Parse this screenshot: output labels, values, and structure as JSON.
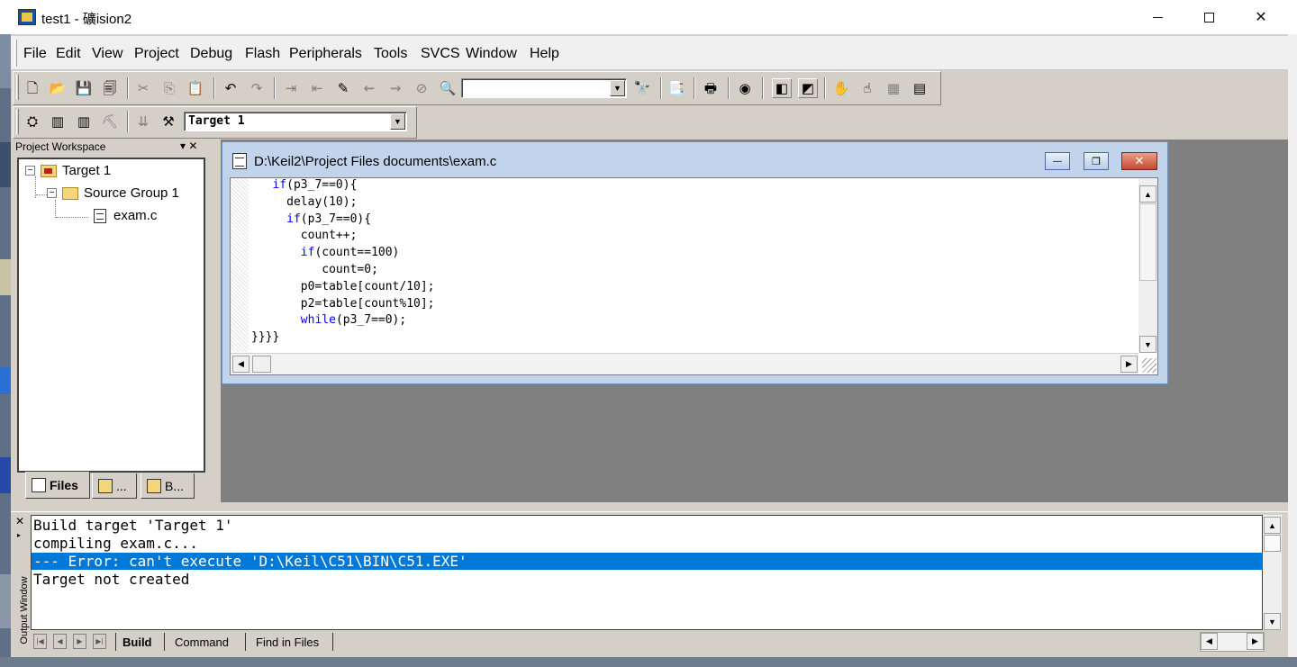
{
  "window": {
    "title": "test1  - 礦ision2",
    "minimize_label": "",
    "maximize_label": "",
    "close_label": "✕"
  },
  "menu": [
    "File",
    "Edit",
    "View",
    "Project",
    "Debug",
    "Flash",
    "Peripherals",
    "Tools",
    "SVCS",
    "Window",
    "Help"
  ],
  "toolbar": {
    "find_combo_value": "",
    "target_combo_value": "Target 1"
  },
  "workspace": {
    "title": "Project Workspace",
    "controls": "▾ ✕",
    "tree": {
      "target": "Target 1",
      "group": "Source Group 1",
      "file": "exam.c",
      "expand_glyph": "−"
    },
    "tabs": [
      "Files",
      "...",
      "B..."
    ]
  },
  "editor": {
    "title": "D:\\Keil2\\Project Files documents\\exam.c",
    "code": [
      {
        "indent": "   ",
        "kw": "if",
        "rest": "(p3_7==0){"
      },
      {
        "indent": "     ",
        "kw": "",
        "rest": "delay(10);"
      },
      {
        "indent": "     ",
        "kw": "if",
        "rest": "(p3_7==0){"
      },
      {
        "indent": "       ",
        "kw": "",
        "rest": "count++;"
      },
      {
        "indent": "       ",
        "kw": "if",
        "rest": "(count==100)"
      },
      {
        "indent": "          ",
        "kw": "",
        "rest": "count=0;"
      },
      {
        "indent": "       ",
        "kw": "",
        "rest": "p0=table[count/10];"
      },
      {
        "indent": "       ",
        "kw": "",
        "rest": "p2=table[count%10];"
      },
      {
        "indent": "       ",
        "kw": "while",
        "rest": "(p3_7==0);"
      },
      {
        "indent": "",
        "kw": "",
        "rest": "}}}}"
      }
    ],
    "min_label": "—",
    "restore_label": "❐",
    "close_label": "✕"
  },
  "output": {
    "window_label": "Output Window",
    "close_label": "✕",
    "lines": [
      "Build target 'Target 1'",
      "compiling exam.c...",
      "--- Error: can't execute 'D:\\Keil\\C51\\BIN\\C51.EXE'",
      "Target not created"
    ],
    "selected_line": 2,
    "tabs": [
      "Build",
      "Command",
      "Find in Files"
    ]
  },
  "colors": {
    "selection": "#0078d7",
    "keyword": "#0000ff",
    "frame": "#d4d0c8"
  }
}
